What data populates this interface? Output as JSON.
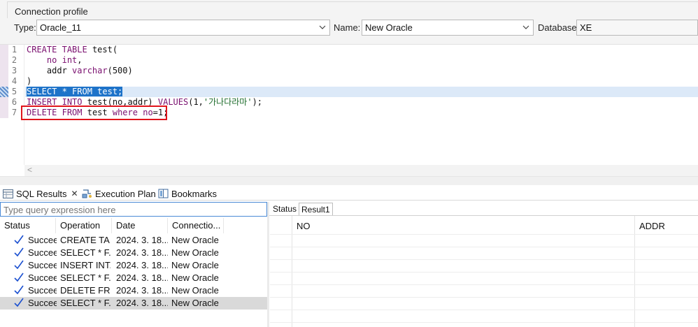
{
  "connection": {
    "title": "Connection profile",
    "type_label": "Type:",
    "type_value": "Oracle_11",
    "name_label": "Name:",
    "name_value": "New Oracle",
    "database_label": "Database:",
    "database_value": "XE"
  },
  "editor": {
    "line_numbers": [
      "1",
      "2",
      "3",
      "4",
      "5",
      "6",
      "7"
    ],
    "current_line": 5,
    "highlighted_line": 7
  },
  "tabs": {
    "sql_results": "SQL Results",
    "close_glyph": "✕",
    "execution_plan": "Execution Plan",
    "bookmarks": "Bookmarks"
  },
  "results_panel": {
    "query_placeholder": "Type query expression here",
    "columns": [
      "Status",
      "Operation",
      "Date",
      "Connectio..."
    ],
    "rows": [
      {
        "status": "Succeeded",
        "operation": "CREATE TA...",
        "date": "2024. 3. 18...",
        "connection": "New Oracle",
        "selected": false
      },
      {
        "status": "Succeeded",
        "operation": "SELECT * F...",
        "date": "2024. 3. 18...",
        "connection": "New Oracle",
        "selected": false
      },
      {
        "status": "Succeeded",
        "operation": "INSERT INT...",
        "date": "2024. 3. 18...",
        "connection": "New Oracle",
        "selected": false
      },
      {
        "status": "Succeeded",
        "operation": "SELECT * F...",
        "date": "2024. 3. 18...",
        "connection": "New Oracle",
        "selected": false
      },
      {
        "status": "Succeeded",
        "operation": "DELETE FR...",
        "date": "2024. 3. 18...",
        "connection": "New Oracle",
        "selected": false
      },
      {
        "status": "Succeeded",
        "operation": "SELECT * F...",
        "date": "2024. 3. 18...",
        "connection": "New Oracle",
        "selected": true
      }
    ]
  },
  "result_grid": {
    "tabs": [
      "Status",
      "Result1"
    ],
    "active_tab": "Result1",
    "columns": [
      "NO",
      "ADDR"
    ]
  },
  "colors": {
    "selection": "#1e73c9",
    "keyword": "#7a0f6f",
    "highlight_box": "#e0131b",
    "check": "#1a4fd0"
  },
  "icons": {
    "combo_arrow": "chevron-down-icon",
    "status_ok": "check-icon",
    "sql_results_tab": "table-icon",
    "execution_plan_tab": "plan-icon",
    "bookmarks_tab": "bookmark-icon"
  }
}
